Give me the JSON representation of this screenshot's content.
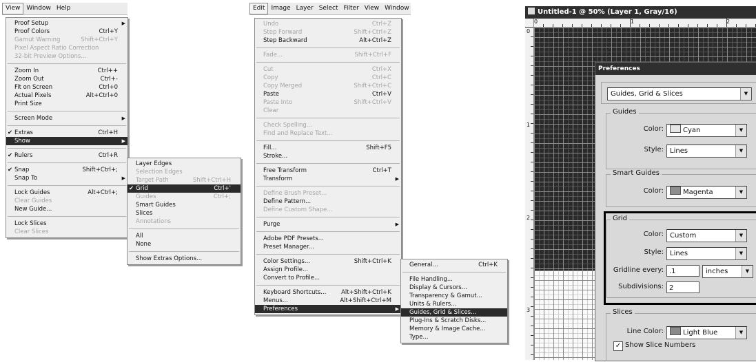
{
  "view_panel": {
    "menubar": [
      "View",
      "Window",
      "Help"
    ],
    "view_menu": [
      {
        "label": "Proof Setup",
        "arrow": true
      },
      {
        "label": "Proof Colors",
        "shortcut": "Ctrl+Y"
      },
      {
        "label": "Gamut Warning",
        "shortcut": "Shift+Ctrl+Y",
        "disabled": true
      },
      {
        "label": "Pixel Aspect Ratio Correction",
        "disabled": true
      },
      {
        "label": "32-bit Preview Options...",
        "disabled": true
      },
      {
        "sep": true
      },
      {
        "label": "Zoom In",
        "shortcut": "Ctrl++"
      },
      {
        "label": "Zoom Out",
        "shortcut": "Ctrl+-"
      },
      {
        "label": "Fit on Screen",
        "shortcut": "Ctrl+0"
      },
      {
        "label": "Actual Pixels",
        "shortcut": "Alt+Ctrl+0"
      },
      {
        "label": "Print Size"
      },
      {
        "sep": true
      },
      {
        "label": "Screen Mode",
        "arrow": true
      },
      {
        "sep": true
      },
      {
        "label": "Extras",
        "shortcut": "Ctrl+H",
        "checked": true
      },
      {
        "label": "Show",
        "arrow": true,
        "selected": true
      },
      {
        "sep": true
      },
      {
        "label": "Rulers",
        "shortcut": "Ctrl+R",
        "checked": true
      },
      {
        "sep": true
      },
      {
        "label": "Snap",
        "shortcut": "Shift+Ctrl+;",
        "checked": true
      },
      {
        "label": "Snap To",
        "arrow": true
      },
      {
        "sep": true
      },
      {
        "label": "Lock Guides",
        "shortcut": "Alt+Ctrl+;"
      },
      {
        "label": "Clear Guides",
        "disabled": true
      },
      {
        "label": "New Guide..."
      },
      {
        "sep": true
      },
      {
        "label": "Lock Slices"
      },
      {
        "label": "Clear Slices",
        "disabled": true
      }
    ],
    "show_menu": [
      {
        "label": "Layer Edges"
      },
      {
        "label": "Selection Edges",
        "disabled": true
      },
      {
        "label": "Target Path",
        "shortcut": "Shift+Ctrl+H",
        "disabled": true
      },
      {
        "label": "Grid",
        "shortcut": "Ctrl+'",
        "checked": true,
        "selected": true
      },
      {
        "label": "Guides",
        "shortcut": "Ctrl+;",
        "disabled": true
      },
      {
        "label": "Smart Guides"
      },
      {
        "label": "Slices"
      },
      {
        "label": "Annotations",
        "disabled": true
      },
      {
        "sep": true
      },
      {
        "label": "All"
      },
      {
        "label": "None"
      },
      {
        "sep": true
      },
      {
        "label": "Show Extras Options..."
      }
    ]
  },
  "edit_panel": {
    "menubar": [
      "Edit",
      "Image",
      "Layer",
      "Select",
      "Filter",
      "View",
      "Window"
    ],
    "edit_menu": [
      {
        "label": "Undo",
        "shortcut": "Ctrl+Z",
        "disabled": true
      },
      {
        "label": "Step Forward",
        "shortcut": "Shift+Ctrl+Z",
        "disabled": true
      },
      {
        "label": "Step Backward",
        "shortcut": "Alt+Ctrl+Z"
      },
      {
        "sep": true
      },
      {
        "label": "Fade...",
        "shortcut": "Shift+Ctrl+F",
        "disabled": true
      },
      {
        "sep": true
      },
      {
        "label": "Cut",
        "shortcut": "Ctrl+X",
        "disabled": true
      },
      {
        "label": "Copy",
        "shortcut": "Ctrl+C",
        "disabled": true
      },
      {
        "label": "Copy Merged",
        "shortcut": "Shift+Ctrl+C",
        "disabled": true
      },
      {
        "label": "Paste",
        "shortcut": "Ctrl+V"
      },
      {
        "label": "Paste Into",
        "shortcut": "Shift+Ctrl+V",
        "disabled": true
      },
      {
        "label": "Clear",
        "disabled": true
      },
      {
        "sep": true
      },
      {
        "label": "Check Spelling...",
        "disabled": true
      },
      {
        "label": "Find and Replace Text...",
        "disabled": true
      },
      {
        "sep": true
      },
      {
        "label": "Fill...",
        "shortcut": "Shift+F5"
      },
      {
        "label": "Stroke..."
      },
      {
        "sep": true
      },
      {
        "label": "Free Transform",
        "shortcut": "Ctrl+T"
      },
      {
        "label": "Transform",
        "arrow": true
      },
      {
        "sep": true
      },
      {
        "label": "Define Brush Preset...",
        "disabled": true
      },
      {
        "label": "Define Pattern..."
      },
      {
        "label": "Define Custom Shape...",
        "disabled": true
      },
      {
        "sep": true
      },
      {
        "label": "Purge",
        "arrow": true
      },
      {
        "sep": true
      },
      {
        "label": "Adobe PDF Presets..."
      },
      {
        "label": "Preset Manager..."
      },
      {
        "sep": true
      },
      {
        "label": "Color Settings...",
        "shortcut": "Shift+Ctrl+K"
      },
      {
        "label": "Assign Profile..."
      },
      {
        "label": "Convert to Profile..."
      },
      {
        "sep": true
      },
      {
        "label": "Keyboard Shortcuts...",
        "shortcut": "Alt+Shift+Ctrl+K"
      },
      {
        "label": "Menus...",
        "shortcut": "Alt+Shift+Ctrl+M"
      },
      {
        "label": "Preferences",
        "arrow": true,
        "selected": true
      }
    ],
    "prefs_menu": [
      {
        "label": "General...",
        "shortcut": "Ctrl+K"
      },
      {
        "sep": true
      },
      {
        "label": "File Handling..."
      },
      {
        "label": "Display & Cursors..."
      },
      {
        "label": "Transparency & Gamut..."
      },
      {
        "label": "Units & Rulers..."
      },
      {
        "label": "Guides, Grid & Slices...",
        "selected": true
      },
      {
        "label": "Plug-Ins & Scratch Disks..."
      },
      {
        "label": "Memory & Image Cache..."
      },
      {
        "label": "Type..."
      }
    ]
  },
  "doc_panel": {
    "title": "Untitled-1 @ 50% (Layer 1, Gray/16)",
    "h_ruler_labels": [
      "0",
      "1",
      "2"
    ],
    "v_ruler_labels": [
      "0",
      "1",
      "2",
      "3"
    ],
    "prefs": {
      "title": "Preferences",
      "section": "Guides, Grid & Slices",
      "guides": {
        "legend": "Guides",
        "color_label": "Color:",
        "color_value": "Cyan",
        "color_swatch": "#e6e6e6",
        "style_label": "Style:",
        "style_value": "Lines"
      },
      "smart_guides": {
        "legend": "Smart Guides",
        "color_label": "Color:",
        "color_value": "Magenta",
        "color_swatch": "#8e8e8e"
      },
      "grid": {
        "legend": "Grid",
        "color_label": "Color:",
        "color_value": "Custom",
        "style_label": "Style:",
        "style_value": "Lines",
        "gridline_label": "Gridline every:",
        "gridline_value": ".1",
        "unit_value": "inches",
        "subdiv_label": "Subdivisions:",
        "subdiv_value": "2"
      },
      "slices": {
        "legend": "Slices",
        "color_label": "Line Color:",
        "color_value": "Light Blue",
        "color_swatch": "#8a8a8a",
        "show_numbers_label": "Show Slice Numbers",
        "show_numbers_checked": true
      }
    }
  }
}
